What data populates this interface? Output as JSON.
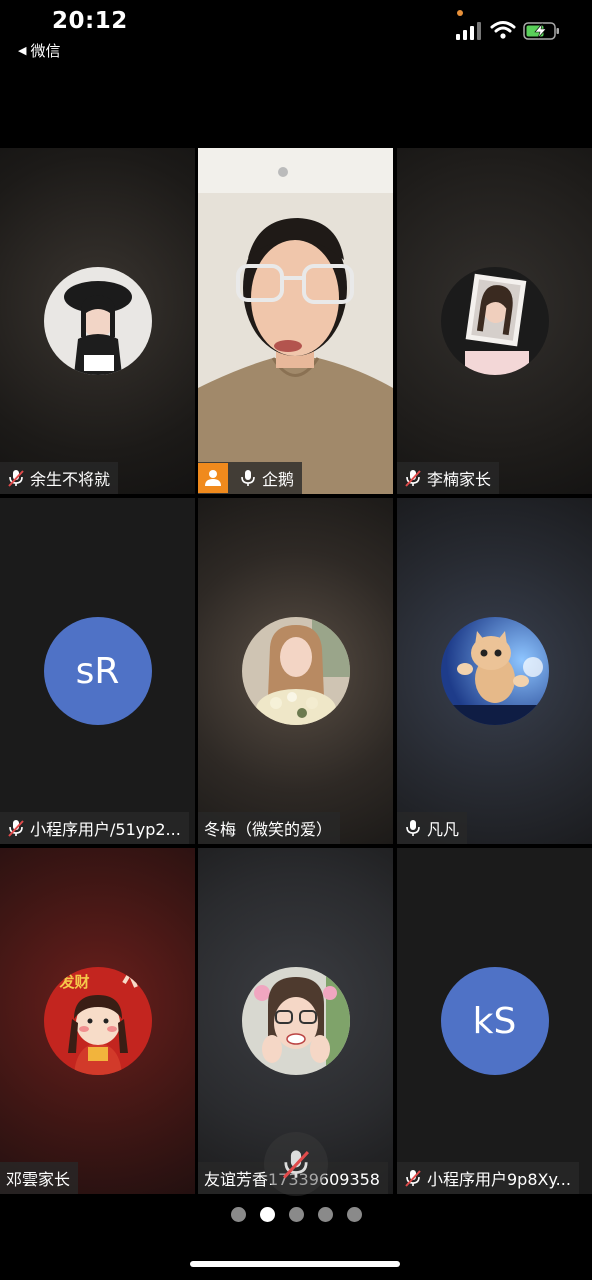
{
  "status_bar": {
    "time": "20:12",
    "back_label": "微信"
  },
  "participants": [
    {
      "name": "余生不将就",
      "mic": "muted",
      "avatar": "photo-girl-beret-icon"
    },
    {
      "name": "企鹅",
      "mic": "on",
      "avatar": "camera-video",
      "host": true,
      "speaking": true
    },
    {
      "name": "李楠家长",
      "mic": "muted",
      "avatar": "photo-frame-girl-icon"
    },
    {
      "name": "小程序用户/51yp2...",
      "mic": "muted",
      "avatar_text": "sR"
    },
    {
      "name": "冬梅（微笑的爱）",
      "mic": "none",
      "avatar": "photo-woman-flowers-icon"
    },
    {
      "name": "凡凡",
      "mic": "on",
      "avatar": "photo-kitten-icon"
    },
    {
      "name": "邓雲家长",
      "mic": "none",
      "avatar": "cartoon-fortune-girl-icon",
      "avatar_caption": "发财"
    },
    {
      "name": "友谊芳香17339609358",
      "mic": "none",
      "avatar": "photo-woman-glasses-icon"
    },
    {
      "name": "小程序用户9p8Xy...",
      "mic": "muted",
      "avatar_text": "kS"
    }
  ],
  "pager": {
    "pages": 5,
    "current": 2
  },
  "colors": {
    "active_border": "#5cc25e",
    "host_badge": "#f08a1d",
    "letter_avatar": "#4f72c6"
  }
}
